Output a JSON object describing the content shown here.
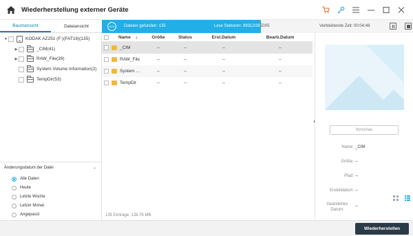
{
  "title": "Wiederherstellung externer Geräte",
  "tabs": [
    {
      "label": "Baumansicht",
      "active": true
    },
    {
      "label": "Dateiansicht",
      "active": false
    }
  ],
  "progress": {
    "percent": 51,
    "percent_label": "51%",
    "found_label": "Dateien gefunden:",
    "found_count": "135",
    "sectors_label": "Lese Sektoren:",
    "sectors_read": "99312/39",
    "sectors_tail": "5005",
    "remaining_label": "Verbleibende Zeit:",
    "remaining_value": "00:04:48"
  },
  "tree": {
    "drive": "KODAK AZ251 (F:)(FAT16)(135)",
    "items": [
      {
        "label": "_CIM(41)",
        "expandable": true
      },
      {
        "label": "RAW_File(39)",
        "expandable": true
      },
      {
        "label": "System Volume Information(2)",
        "expandable": false
      },
      {
        "label": "TempDir(53)",
        "expandable": false
      }
    ]
  },
  "filter": {
    "title": "Änderungsdatum der Datei",
    "options": [
      "Alle Daten",
      "Heute",
      "Letzte Woche",
      "Letzer Monat",
      "Angepasst"
    ],
    "selected": "Alle Daten"
  },
  "table": {
    "columns": [
      "Name",
      "Größe",
      "Status",
      "Erst.Datum",
      "Bearb.Datum"
    ],
    "rows": [
      {
        "name": "_CIM",
        "size": "--",
        "status": "--",
        "created": "--",
        "modified": "--"
      },
      {
        "name": "RAW_File",
        "size": "--",
        "status": "--",
        "created": "--",
        "modified": "--"
      },
      {
        "name": "System ...",
        "size": "--",
        "status": "--",
        "created": "--",
        "modified": "--"
      },
      {
        "name": "TempDir",
        "size": "--",
        "status": "--",
        "created": "--",
        "modified": "--"
      }
    ],
    "footer": "135 Einträge, 128.76 MB"
  },
  "preview": {
    "button": "Vorschau",
    "props": [
      {
        "label": "Name:",
        "value": "_CIM"
      },
      {
        "label": "Größe:",
        "value": "--"
      },
      {
        "label": "Pfad:",
        "value": "--"
      },
      {
        "label": "Erstelldatum:",
        "value": "--"
      },
      {
        "label": "Geändertes Datum:",
        "value": "--"
      }
    ]
  },
  "actions": {
    "recover": "Wiederherstellen"
  },
  "colors": {
    "accent": "#22aee6",
    "dark_button": "#2b3a47",
    "cart": "#e8642c",
    "key": "#1a9bd7"
  },
  "icons": [
    "home-icon",
    "cart-icon",
    "key-icon",
    "menu-icon",
    "minimize-icon",
    "maximize-icon",
    "close-icon",
    "folder-icon",
    "drive-icon",
    "sort-icon",
    "grid-view-icon",
    "list-view-icon",
    "pause-icon",
    "stop-icon"
  ]
}
